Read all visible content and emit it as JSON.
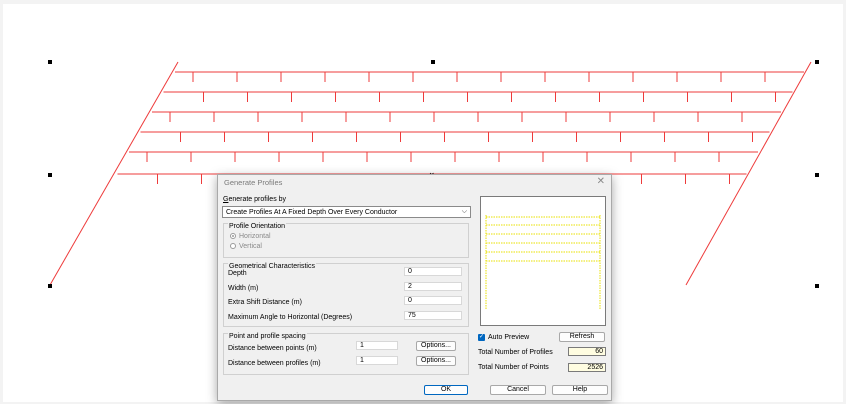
{
  "dialog": {
    "title": "Generate Profiles",
    "close_glyph": "✕",
    "generate_by_label": "Generate profiles by",
    "method_selected": "Create Profiles At A Fixed Depth Over Every Conductor",
    "orientation": {
      "legend": "Profile Orientation",
      "horizontal_label": "Horizontal",
      "vertical_label": "Vertical",
      "selected": "Horizontal"
    },
    "geometry": {
      "legend": "Geometrical Characteristics",
      "depth_label": "Depth",
      "depth_value": "0",
      "width_label": "Width (m)",
      "width_value": "2",
      "extra_shift_label": "Extra Shift Distance (m)",
      "extra_shift_value": "0",
      "max_angle_label": "Maximum Angle to Horizontal (Degrees)",
      "max_angle_value": "75"
    },
    "spacing": {
      "legend": "Point and profile spacing",
      "points_label": "Distance between points (m)",
      "points_value": "1",
      "profiles_label": "Distance between profiles (m)",
      "profiles_value": "1",
      "options_label": "Options..."
    },
    "auto_preview_label": "Auto Preview",
    "auto_preview_checked": true,
    "refresh_label": "Refresh",
    "total_profiles_label": "Total Number of Profiles",
    "total_profiles_value": "60",
    "total_points_label": "Total Number of Points",
    "total_points_value": "2526",
    "ok_label": "OK",
    "cancel_label": "Cancel",
    "help_label": "Help"
  },
  "colors": {
    "profile_line": "#ee3b3b",
    "preview_line": "#e8e000",
    "accent": "#0067c0"
  }
}
